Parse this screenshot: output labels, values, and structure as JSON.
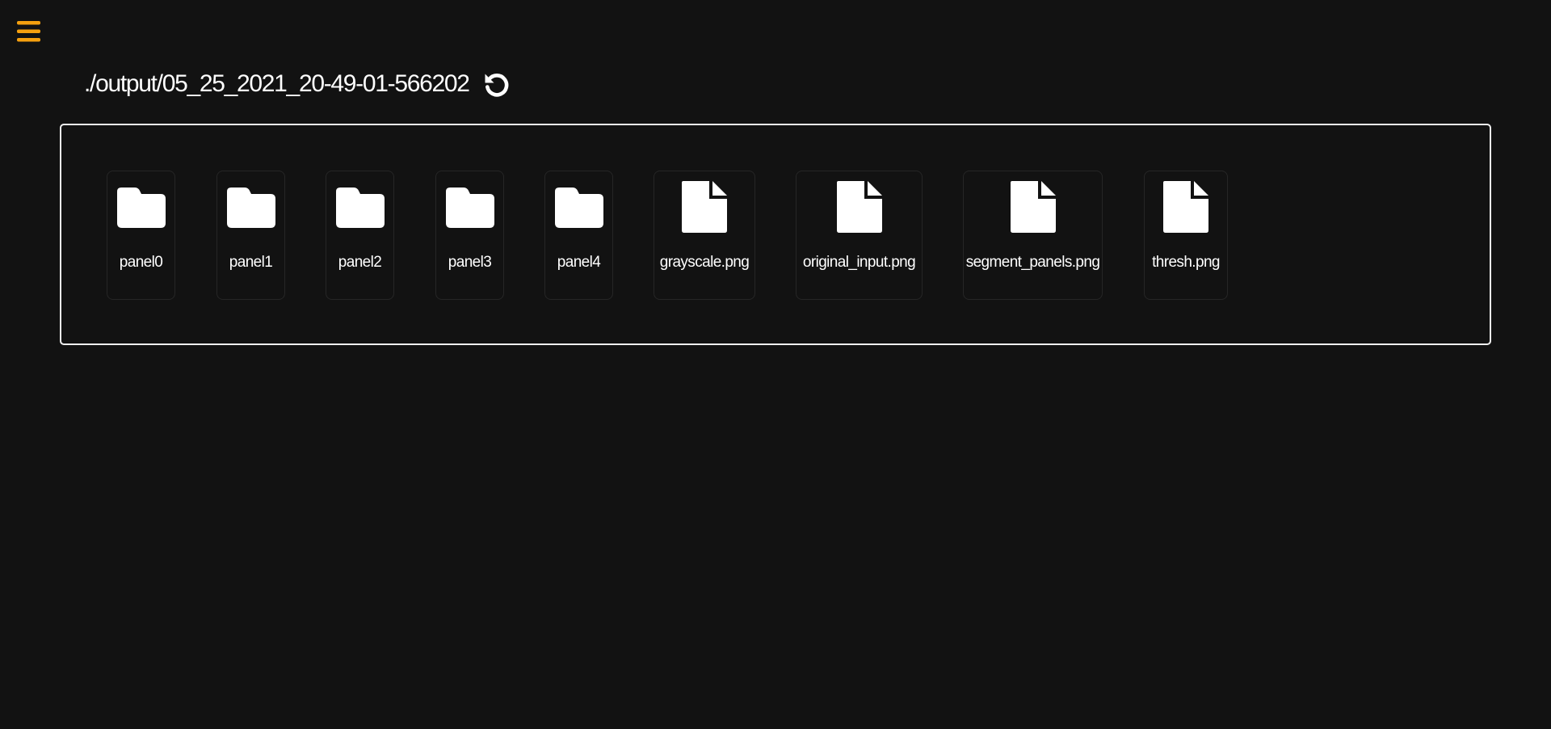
{
  "app": {
    "accent_color": "#f5a00f",
    "background_color": "#121212",
    "menu_icon": "hamburger-menu-icon"
  },
  "header": {
    "current_path": "./output/05_25_2021_20-49-01-566202",
    "refresh_icon": "refresh-icon"
  },
  "entries": [
    {
      "name": "panel0",
      "type": "folder",
      "icon": "folder-icon"
    },
    {
      "name": "panel1",
      "type": "folder",
      "icon": "folder-icon"
    },
    {
      "name": "panel2",
      "type": "folder",
      "icon": "folder-icon"
    },
    {
      "name": "panel3",
      "type": "folder",
      "icon": "folder-icon"
    },
    {
      "name": "panel4",
      "type": "folder",
      "icon": "folder-icon"
    },
    {
      "name": "grayscale.png",
      "type": "file",
      "icon": "file-icon"
    },
    {
      "name": "original_input.png",
      "type": "file",
      "icon": "file-icon"
    },
    {
      "name": "segment_panels.png",
      "type": "file",
      "icon": "file-icon"
    },
    {
      "name": "thresh.png",
      "type": "file",
      "icon": "file-icon"
    }
  ]
}
